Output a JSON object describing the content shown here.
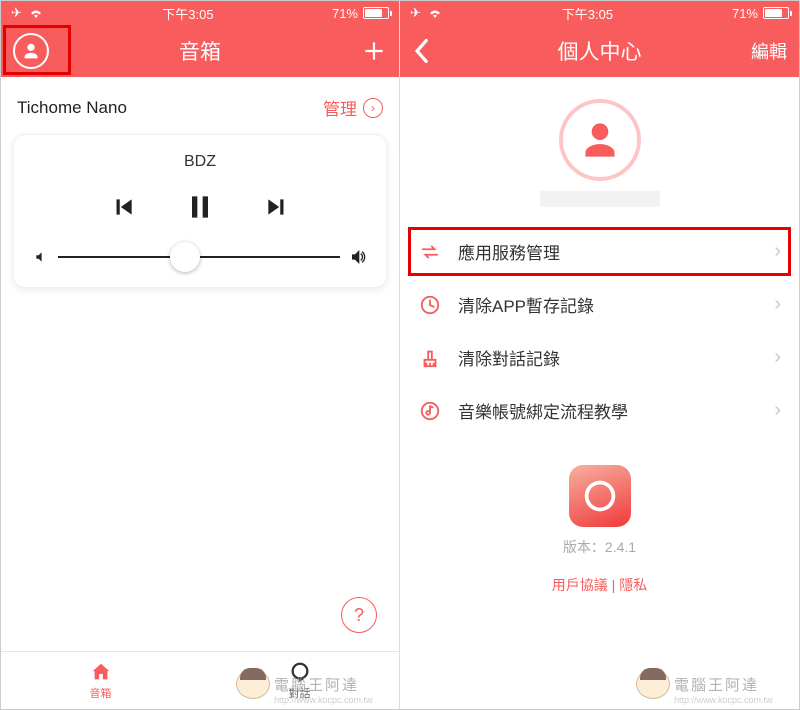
{
  "status": {
    "time": "下午3:05",
    "battery": "71%"
  },
  "left": {
    "nav_title": "音箱",
    "device_name": "Tichome Nano",
    "manage": "管理",
    "track": "BDZ",
    "help": "?",
    "tabs": {
      "speaker": "音箱",
      "dialog": "對話"
    }
  },
  "right": {
    "nav_title": "個人中心",
    "edit": "編輯",
    "items": [
      {
        "label": "應用服務管理"
      },
      {
        "label": "清除APP暫存記錄"
      },
      {
        "label": "清除對話記錄"
      },
      {
        "label": "音樂帳號綁定流程教學"
      }
    ],
    "version_prefix": "版本：",
    "version": "2.4.1",
    "agreement": "用戶協議",
    "divider": " | ",
    "privacy": "隱私"
  },
  "watermark": {
    "text": "電腦王阿達",
    "url": "http://www.kocpc.com.tw"
  }
}
